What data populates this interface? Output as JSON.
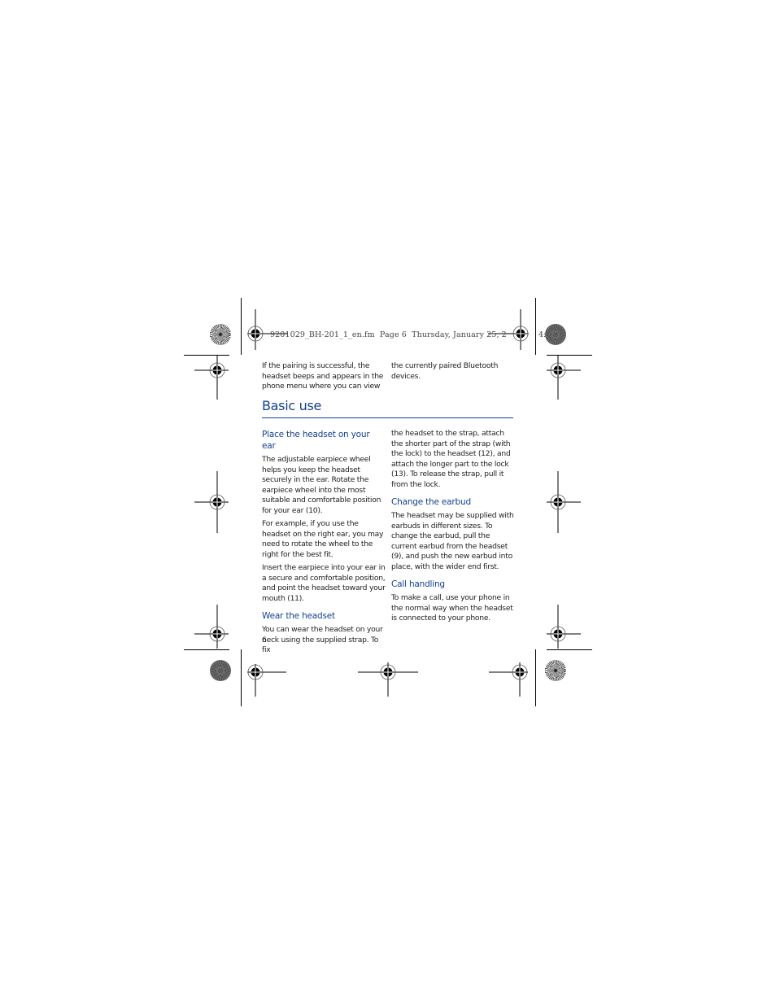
{
  "slug": {
    "text": "9201029_BH-201_1_en.fm  Page 6  Thursday, January 25, 2",
    "tail": "4:"
  },
  "intro": {
    "left": "If the pairing is successful, the headset beeps and appears in the phone menu where you can view",
    "right": "the currently paired Bluetooth devices."
  },
  "section": {
    "title": "Basic use"
  },
  "left_column": {
    "place_heading": "Place the headset on your ear",
    "place_p1": "The adjustable earpiece wheel helps you keep the headset securely in the ear. Rotate the earpiece wheel into the most suitable and comfortable position for your ear (10).",
    "place_p2": "For example, if you use the headset on the right ear, you may need to rotate the wheel to the right for the best fit.",
    "place_p3": "Insert the earpiece into your ear in a secure and comfortable position, and point the headset toward your mouth (11).",
    "wear_heading": "Wear the headset",
    "wear_p1": "You can wear the headset on your neck using the supplied strap. To fix"
  },
  "right_column": {
    "wear_p1_cont": "the headset to the strap, attach the shorter part of the strap (with the lock) to the headset (12), and attach the longer part to the lock (13). To release the strap, pull it from the lock.",
    "earbud_heading": "Change the earbud",
    "earbud_p1": "The headset may be supplied with earbuds in different sizes. To change the earbud, pull the current earbud from the headset (9), and push the new earbud into place, with the wider end first.",
    "call_heading": "Call handling",
    "call_p1": "To make a call, use your phone in the normal way when the headset is connected to your phone."
  },
  "page_number": "6",
  "colors": {
    "heading": "#124191",
    "text": "#222222"
  }
}
